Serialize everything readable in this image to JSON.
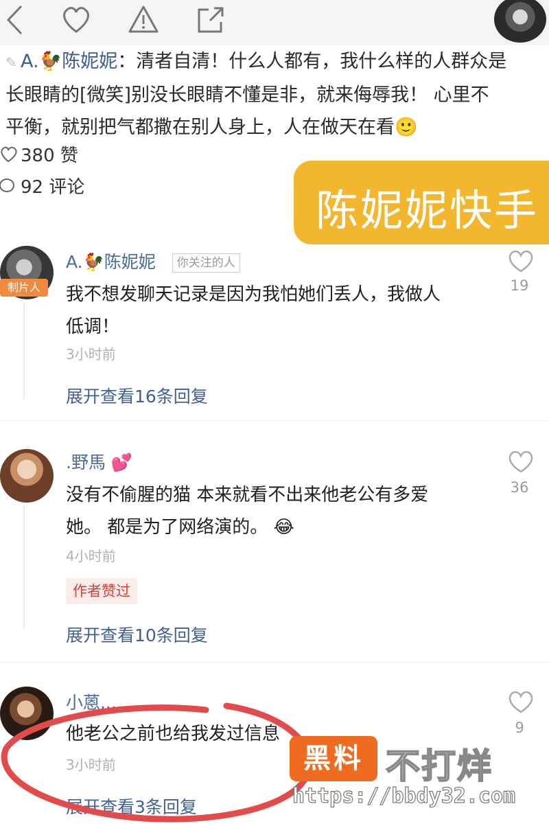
{
  "topbar": {
    "back_icon": "chevron-left-icon",
    "like_icon": "heart-outline-icon",
    "report_icon": "warning-triangle-icon",
    "share_icon": "share-out-icon"
  },
  "post": {
    "author": "A.🐓陈妮妮",
    "line1_rest": "：清者自清！什么人都有，我什么样的人群众是",
    "line2": "长眼睛的[微笑]别没长眼睛不懂是非，就来侮辱我！ 心里不",
    "line3": "平衡，就别把气都撒在别人身上，人在做天在看🙂",
    "likes": "380 赞",
    "comments": "92 评论"
  },
  "banner": {
    "text": "陈妮妮快手"
  },
  "comments": [
    {
      "avatar_tag": "制片人",
      "name": "A.🐓陈妮妮",
      "follow_badge": "你关注的人",
      "text_line1": "我不想发聊天记录是因为我怕她们丢人，我做人",
      "text_line2": "低调！",
      "time": "3小时前",
      "replies": "展开查看16条回复",
      "likes": "19"
    },
    {
      "name": ".野馬 💕",
      "text_line1": "没有不偷腥的猫 本来就看不出来他老公有多爱",
      "text_line2": "她。 都是为了网络演的。 😂",
      "time": "4小时前",
      "author_liked": "作者赞过",
      "replies": "展开查看10条回复",
      "likes": "36"
    },
    {
      "name": "小蒽....",
      "text_line1": "他老公之前也给我发过信息",
      "time": "3小时前",
      "replies": "展开查看3条回复",
      "likes": "9"
    }
  ],
  "watermark": {
    "badge": "黑料",
    "text": "不打烊",
    "url": "https://bbdy32.com"
  },
  "colors": {
    "link_blue": "#3f5f96",
    "banner_yellow": "#f2b72f",
    "annotation_red": "#e14b4b",
    "watermark_orange": "#ee6b1f"
  }
}
